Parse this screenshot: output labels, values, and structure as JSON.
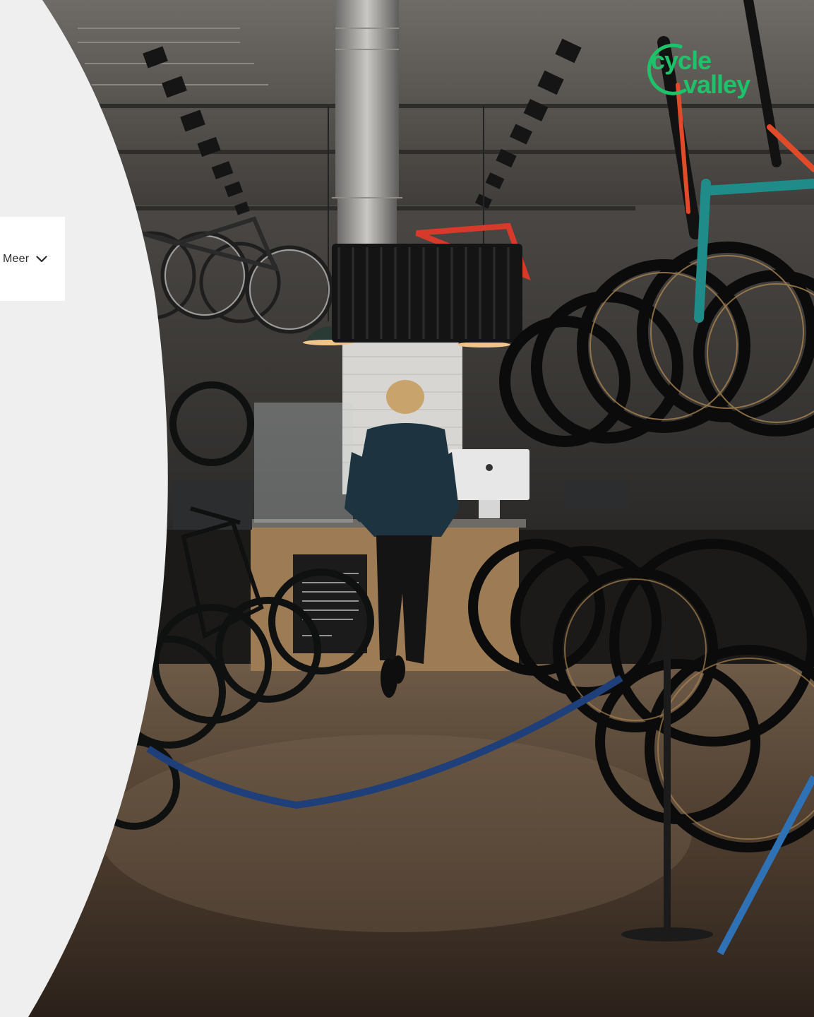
{
  "brand": {
    "logo_line_1": "cycle",
    "logo_line_2": "valley",
    "color": "#1ec26a"
  },
  "nav": {
    "more_label": "Meer",
    "more_icon": "chevron-down-icon"
  },
  "colors": {
    "panel": "#efefef",
    "dropdown_background": "#ffffff",
    "text": "#2b2b2b"
  }
}
